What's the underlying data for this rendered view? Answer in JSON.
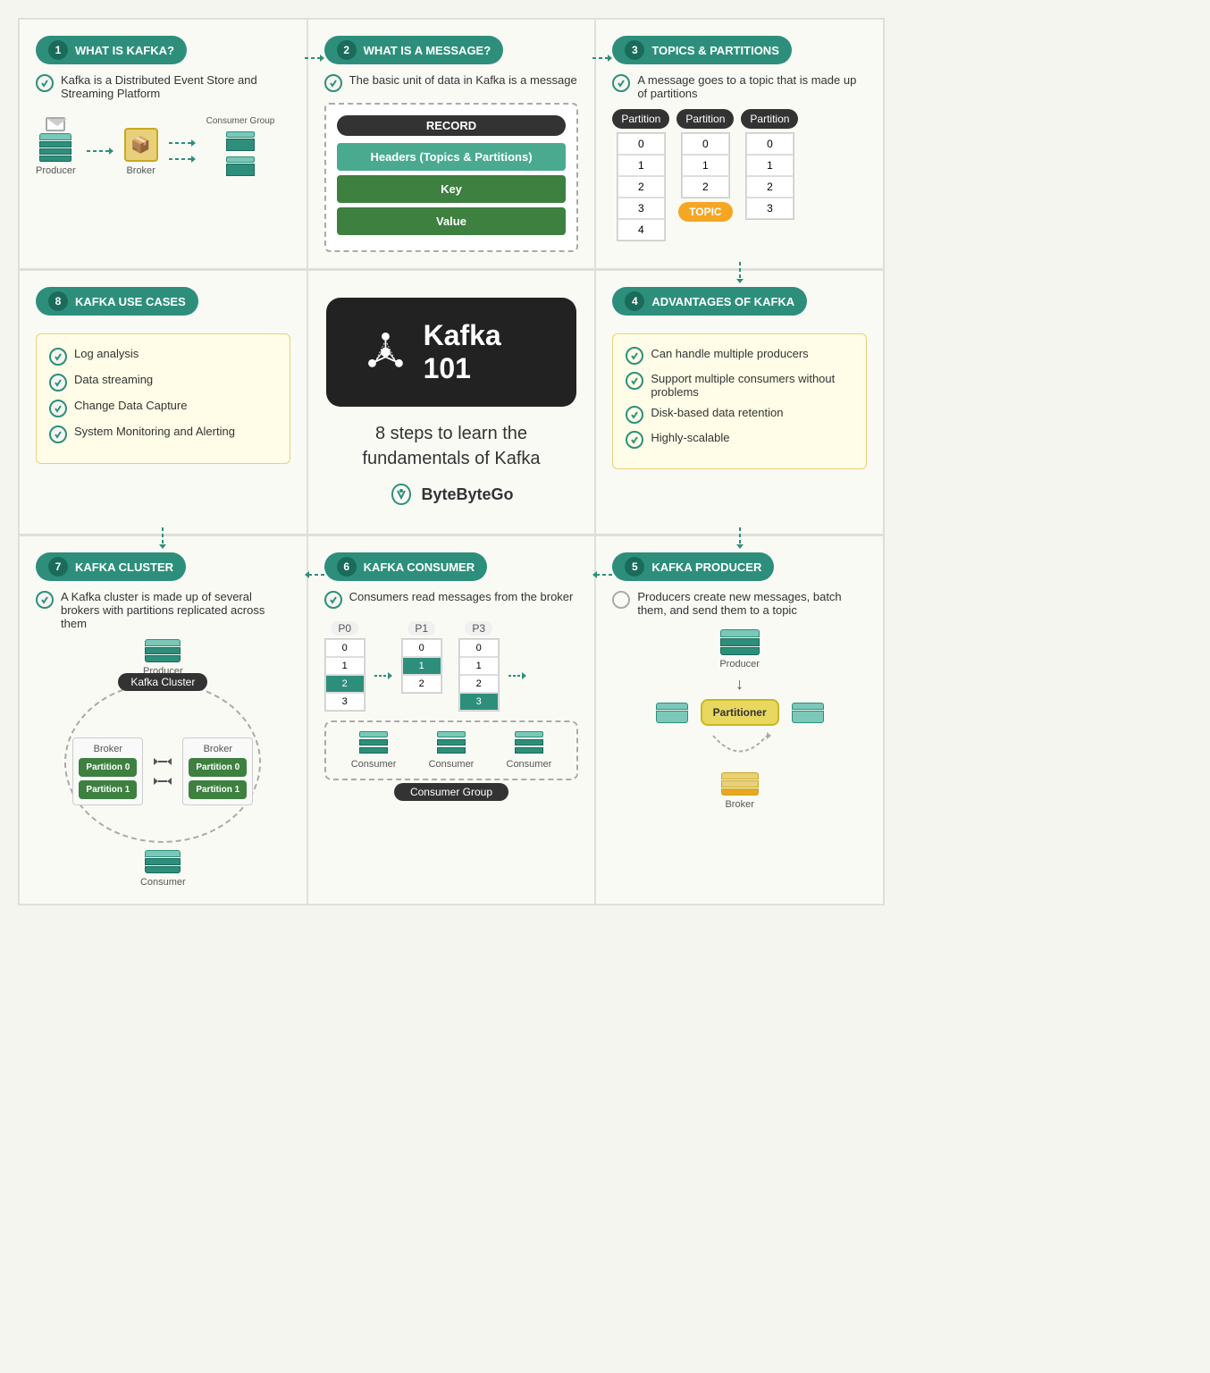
{
  "sections": {
    "s1": {
      "num": "1",
      "title": "WHAT IS KAFKA?",
      "desc": "Kafka is a Distributed Event Store and Streaming Platform",
      "labels": {
        "producer": "Producer",
        "broker": "Broker",
        "consumer_group": "Consumer Group"
      }
    },
    "s2": {
      "num": "2",
      "title": "WHAT IS A MESSAGE?",
      "desc": "The basic unit of data in Kafka is a message",
      "record": "RECORD",
      "row1": "Headers (Topics & Partitions)",
      "row2": "Key",
      "row3": "Value"
    },
    "s3": {
      "num": "3",
      "title": "TOPICS & PARTITIONS",
      "desc": "A message goes to a topic that is made up of partitions",
      "partition_label": "Partition",
      "topic_label": "TOPIC"
    },
    "s8": {
      "num": "8",
      "title": "KAFKA USE CASES",
      "items": [
        "Log analysis",
        "Data streaming",
        "Change Data Capture",
        "System Monitoring and Alerting"
      ]
    },
    "center": {
      "title": "Kafka 101",
      "subtitle": "8 steps to learn the\nfundamentals of Kafka",
      "brand": "ByteByteGo"
    },
    "s4": {
      "num": "4",
      "title": "ADVANTAGES OF KAFKA",
      "items": [
        "Can handle multiple producers",
        "Support multiple consumers without problems",
        "Disk-based data retention",
        "Highly-scalable"
      ]
    },
    "s7": {
      "num": "7",
      "title": "KAFKA CLUSTER",
      "desc": "A Kafka cluster is made up of several brokers with partitions replicated across them",
      "kafka_cluster": "Kafka Cluster",
      "producer": "Producer",
      "consumer": "Consumer",
      "broker": "Broker",
      "partitions": [
        "Partition 0",
        "Partition 1"
      ]
    },
    "s6": {
      "num": "6",
      "title": "KAFKA CONSUMER",
      "desc": "Consumers read messages from the broker",
      "p_labels": [
        "P0",
        "P1",
        "P3"
      ],
      "consumer_group": "Consumer Group",
      "consumer_label": "Consumer"
    },
    "s5": {
      "num": "5",
      "title": "KAFKA PRODUCER",
      "desc": "Producers create new messages, batch them, and send them to a topic",
      "producer": "Producer",
      "partitioner": "Partitioner",
      "broker": "Broker"
    }
  }
}
